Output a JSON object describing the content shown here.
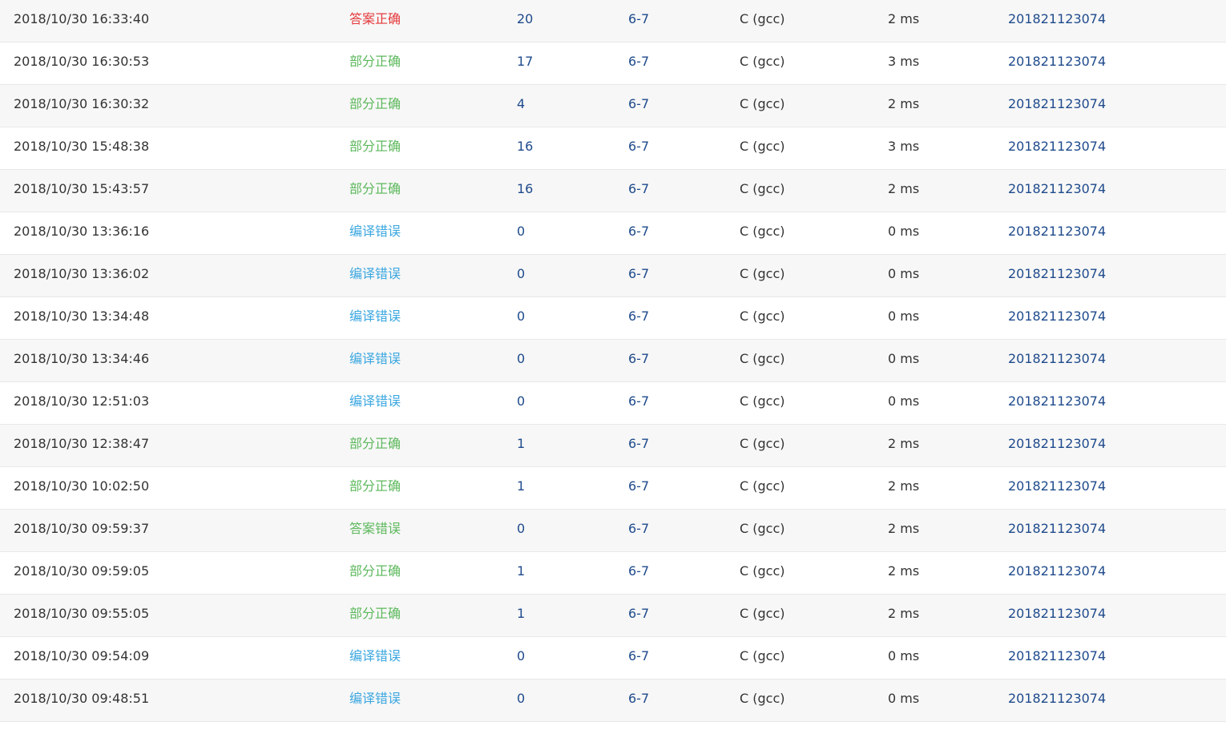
{
  "colors": {
    "answer_correct": "#e4393c",
    "partial_correct": "#5cb85c",
    "compile_error": "#3ba7e0",
    "wrong_answer": "#5cb85c",
    "link": "#1e4a8c",
    "text": "#333333",
    "stripe": "#f7f7f7",
    "border": "#e8e8e8"
  },
  "submissions": [
    {
      "time": "2018/10/30 16:33:40",
      "status": "答案正确",
      "status_type": "ac",
      "score": "20",
      "problem": "6-7",
      "language": "C (gcc)",
      "time_used": "2 ms",
      "user": "201821123074"
    },
    {
      "time": "2018/10/30 16:30:53",
      "status": "部分正确",
      "status_type": "pa",
      "score": "17",
      "problem": "6-7",
      "language": "C (gcc)",
      "time_used": "3 ms",
      "user": "201821123074"
    },
    {
      "time": "2018/10/30 16:30:32",
      "status": "部分正确",
      "status_type": "pa",
      "score": "4",
      "problem": "6-7",
      "language": "C (gcc)",
      "time_used": "2 ms",
      "user": "201821123074"
    },
    {
      "time": "2018/10/30 15:48:38",
      "status": "部分正确",
      "status_type": "pa",
      "score": "16",
      "problem": "6-7",
      "language": "C (gcc)",
      "time_used": "3 ms",
      "user": "201821123074"
    },
    {
      "time": "2018/10/30 15:43:57",
      "status": "部分正确",
      "status_type": "pa",
      "score": "16",
      "problem": "6-7",
      "language": "C (gcc)",
      "time_used": "2 ms",
      "user": "201821123074"
    },
    {
      "time": "2018/10/30 13:36:16",
      "status": "编译错误",
      "status_type": "ce",
      "score": "0",
      "problem": "6-7",
      "language": "C (gcc)",
      "time_used": "0 ms",
      "user": "201821123074"
    },
    {
      "time": "2018/10/30 13:36:02",
      "status": "编译错误",
      "status_type": "ce",
      "score": "0",
      "problem": "6-7",
      "language": "C (gcc)",
      "time_used": "0 ms",
      "user": "201821123074"
    },
    {
      "time": "2018/10/30 13:34:48",
      "status": "编译错误",
      "status_type": "ce",
      "score": "0",
      "problem": "6-7",
      "language": "C (gcc)",
      "time_used": "0 ms",
      "user": "201821123074"
    },
    {
      "time": "2018/10/30 13:34:46",
      "status": "编译错误",
      "status_type": "ce",
      "score": "0",
      "problem": "6-7",
      "language": "C (gcc)",
      "time_used": "0 ms",
      "user": "201821123074"
    },
    {
      "time": "2018/10/30 12:51:03",
      "status": "编译错误",
      "status_type": "ce",
      "score": "0",
      "problem": "6-7",
      "language": "C (gcc)",
      "time_used": "0 ms",
      "user": "201821123074"
    },
    {
      "time": "2018/10/30 12:38:47",
      "status": "部分正确",
      "status_type": "pa",
      "score": "1",
      "problem": "6-7",
      "language": "C (gcc)",
      "time_used": "2 ms",
      "user": "201821123074"
    },
    {
      "time": "2018/10/30 10:02:50",
      "status": "部分正确",
      "status_type": "pa",
      "score": "1",
      "problem": "6-7",
      "language": "C (gcc)",
      "time_used": "2 ms",
      "user": "201821123074"
    },
    {
      "time": "2018/10/30 09:59:37",
      "status": "答案错误",
      "status_type": "wa",
      "score": "0",
      "problem": "6-7",
      "language": "C (gcc)",
      "time_used": "2 ms",
      "user": "201821123074"
    },
    {
      "time": "2018/10/30 09:59:05",
      "status": "部分正确",
      "status_type": "pa",
      "score": "1",
      "problem": "6-7",
      "language": "C (gcc)",
      "time_used": "2 ms",
      "user": "201821123074"
    },
    {
      "time": "2018/10/30 09:55:05",
      "status": "部分正确",
      "status_type": "pa",
      "score": "1",
      "problem": "6-7",
      "language": "C (gcc)",
      "time_used": "2 ms",
      "user": "201821123074"
    },
    {
      "time": "2018/10/30 09:54:09",
      "status": "编译错误",
      "status_type": "ce",
      "score": "0",
      "problem": "6-7",
      "language": "C (gcc)",
      "time_used": "0 ms",
      "user": "201821123074"
    },
    {
      "time": "2018/10/30 09:48:51",
      "status": "编译错误",
      "status_type": "ce",
      "score": "0",
      "problem": "6-7",
      "language": "C (gcc)",
      "time_used": "0 ms",
      "user": "201821123074"
    }
  ]
}
